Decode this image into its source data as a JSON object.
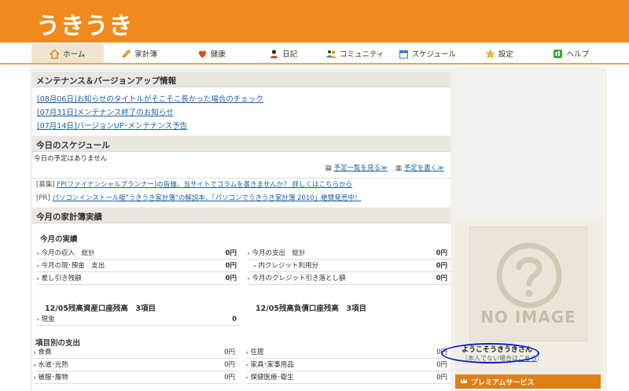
{
  "header": {
    "logo": "うきうき"
  },
  "nav": {
    "items": [
      {
        "label": "ホーム",
        "icon": "home-icon"
      },
      {
        "label": "家計簿",
        "icon": "pencil-icon"
      },
      {
        "label": "健康",
        "icon": "heart-icon"
      },
      {
        "label": "日記",
        "icon": "person-icon"
      },
      {
        "label": "コミュニティ",
        "icon": "people-icon"
      },
      {
        "label": "スケジュール",
        "icon": "calendar-icon"
      },
      {
        "label": "設定",
        "icon": "star-icon"
      },
      {
        "label": "ヘルプ",
        "icon": "help-icon"
      }
    ],
    "active_index": 0
  },
  "maintenance": {
    "title": "メンテナンス＆バージョンアップ情報",
    "links": [
      "[08月06日]お知らせのタイトルがそこそこ長かった場合のチェック",
      "[07月31日]メンテナンス終了のお知らせ",
      "[07月14日]バージョンUP･メンテナンス予告"
    ]
  },
  "schedule": {
    "title": "今日のスケジュール",
    "empty": "今日の予定はありません",
    "list_link": "予定一覧を見る≫",
    "write_link": "予定を書く≫"
  },
  "promos": [
    {
      "tag": "[募集]",
      "text": "FP(ファイナンシャルプランナー)の皆様、当サイトでコラムを書きませんか？ 詳しくはこちらから"
    },
    {
      "tag": "[PR]",
      "text": "パソコンインストール版\"うきうき家計簿\"の解説本、「パソコンでうきうき家計簿 2010」絶賛発売中！"
    }
  ],
  "kakeibo": {
    "title": "今月の家計簿実績",
    "results_title": "今月の実績",
    "left_rows": [
      {
        "label": "今月の収入　総計",
        "value": "0円"
      },
      {
        "label": "今月の現･預金　支出",
        "value": "0円"
      },
      {
        "label": "差し引き残額",
        "value": "0円"
      }
    ],
    "right_rows": [
      {
        "label": "今月の支出　総計",
        "value": "0円"
      },
      {
        "label": "内クレジット利用分",
        "value": "0円"
      },
      {
        "label": "今月のクレジット引き落とし額",
        "value": "0円"
      }
    ],
    "asset_title": "12/05残高資産口座残高　3項目",
    "asset_rows": [
      {
        "label": "現金",
        "value": "0"
      }
    ],
    "debt_title": "12/05残高負債口座残高　3項目",
    "category_title": "項目別の支出",
    "cat_left": [
      {
        "label": "食費",
        "value": "0円"
      },
      {
        "label": "水道･光熱",
        "value": "0円"
      },
      {
        "label": "被服･履物",
        "value": "0円"
      }
    ],
    "cat_right": [
      {
        "label": "住居",
        "value": "0円"
      },
      {
        "label": "家具･家事用品",
        "value": "0円"
      },
      {
        "label": "保健医療･衛生",
        "value": "0円"
      }
    ]
  },
  "sidebar": {
    "noimage": "NO IMAGE",
    "welcome": "ようこそうきうきさん",
    "note": "（本人でない場合は",
    "note_link": "こちら",
    "note_end": "）",
    "premium": "プレミアムサービス"
  }
}
